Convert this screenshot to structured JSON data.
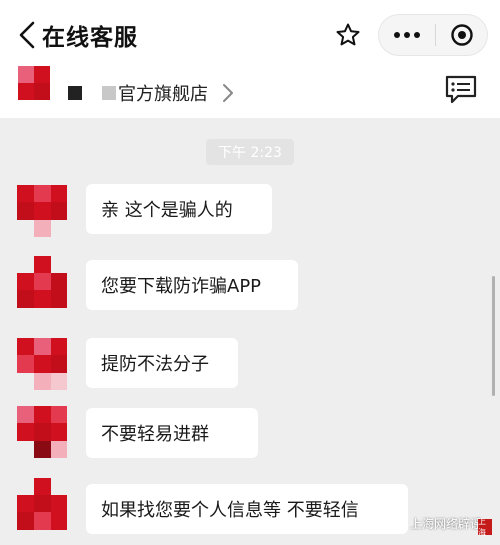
{
  "header": {
    "title": "在线客服",
    "back_icon": "chevron-left-icon",
    "star_icon": "star-outline-icon",
    "more_icon": "more-dots-icon",
    "close_icon": "target-close-icon"
  },
  "shop": {
    "name": "官方旗舰店",
    "chevron_icon": "chevron-right-icon",
    "message_icon": "message-list-icon"
  },
  "time_divider": "下午 2:23",
  "messages": [
    {
      "text": "亲 这个是骗人的"
    },
    {
      "text": "您要下载防诈骗APP"
    },
    {
      "text": "提防不法分子"
    },
    {
      "text": "不要轻易进群"
    },
    {
      "text": "如果找您要个人信息等 不要轻信"
    }
  ],
  "watermark": {
    "text": "上海网络辟谣",
    "seal_text": "上海"
  },
  "colors": {
    "avatar_red": "#d0101e",
    "avatar_pink": "#e8607a",
    "bubble": "#ffffff",
    "background": "#eeeeee"
  }
}
